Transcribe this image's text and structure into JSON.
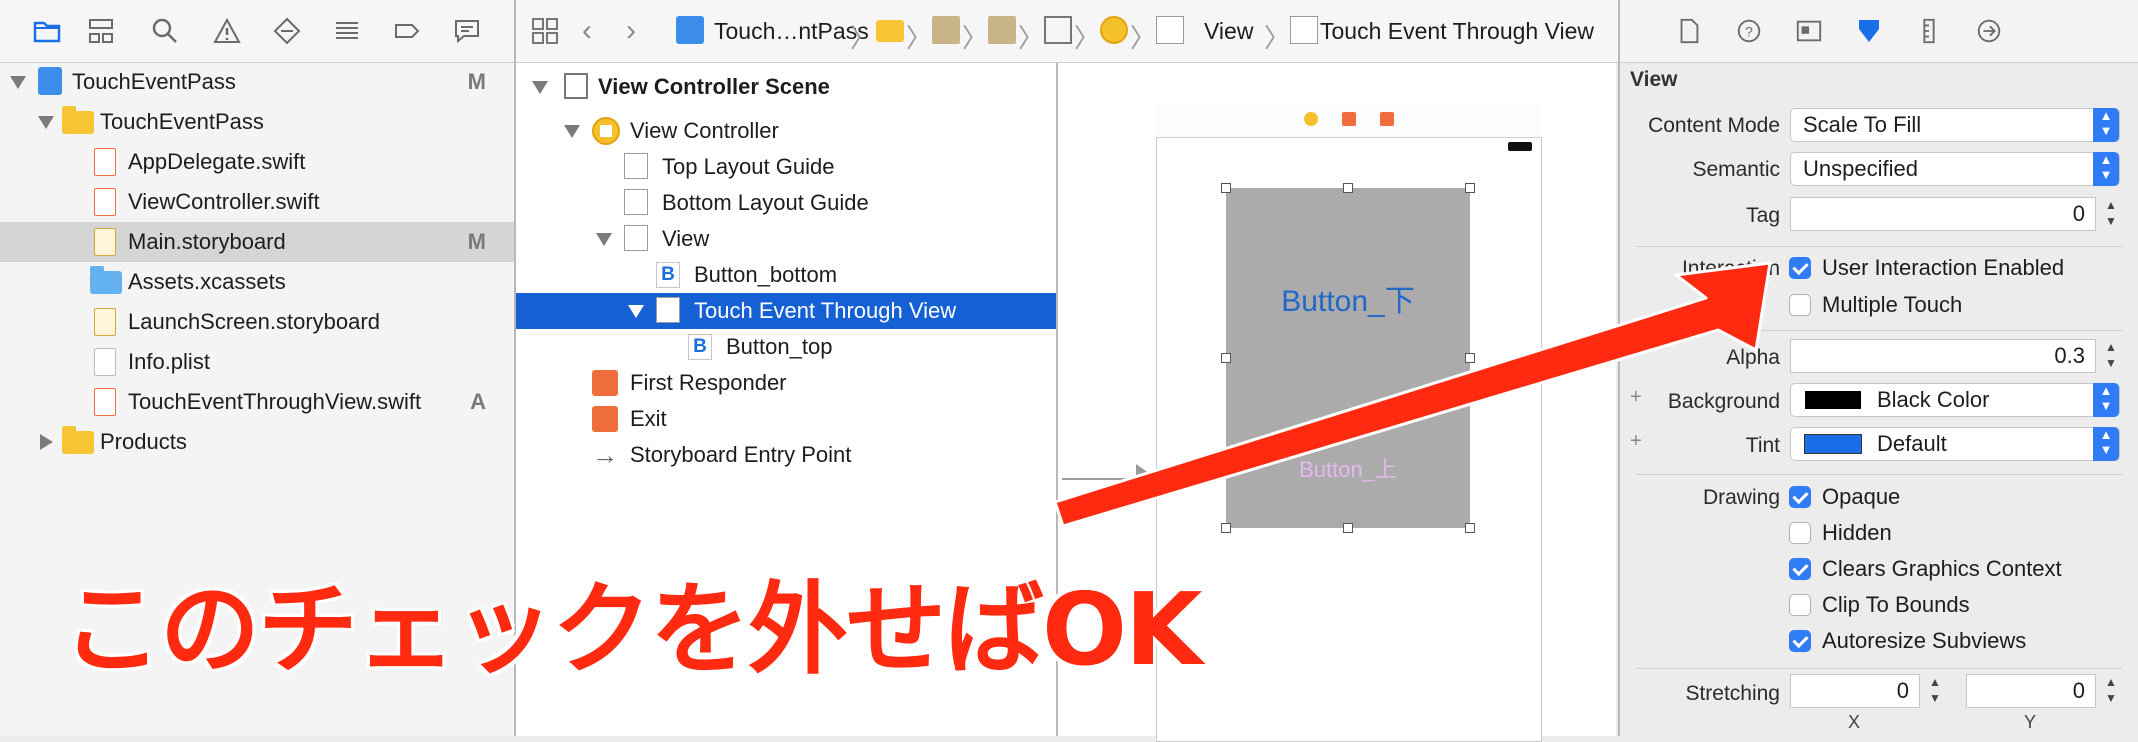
{
  "navigator": {
    "items": [
      {
        "label": "TouchEventPass",
        "badge": "M"
      },
      {
        "label": "TouchEventPass",
        "badge": ""
      },
      {
        "label": "AppDelegate.swift",
        "badge": ""
      },
      {
        "label": "ViewController.swift",
        "badge": ""
      },
      {
        "label": "Main.storyboard",
        "badge": "M"
      },
      {
        "label": "Assets.xcassets",
        "badge": ""
      },
      {
        "label": "LaunchScreen.storyboard",
        "badge": ""
      },
      {
        "label": "Info.plist",
        "badge": ""
      },
      {
        "label": "TouchEventThroughView.swift",
        "badge": "A"
      },
      {
        "label": "Products",
        "badge": ""
      }
    ]
  },
  "jumpbar": {
    "crumbs": [
      "Touch…ntPass",
      "View",
      "Touch Event Through View"
    ]
  },
  "outline": {
    "items": [
      "View Controller Scene",
      "View Controller",
      "Top Layout Guide",
      "Bottom Layout Guide",
      "View",
      "Button_bottom",
      "Touch Event Through View",
      "Button_top",
      "First Responder",
      "Exit",
      "Storyboard Entry Point"
    ],
    "b_glyph": "B"
  },
  "canvas": {
    "button_bottom": "Button_下",
    "button_top": "Button_上"
  },
  "inspector": {
    "section": "View",
    "content_mode_label": "Content Mode",
    "content_mode_value": "Scale To Fill",
    "semantic_label": "Semantic",
    "semantic_value": "Unspecified",
    "tag_label": "Tag",
    "tag_value": "0",
    "interaction_label": "Interaction",
    "user_interaction": "User Interaction Enabled",
    "multiple_touch": "Multiple Touch",
    "alpha_label": "Alpha",
    "alpha_value": "0.3",
    "background_label": "Background",
    "background_value": "Black Color",
    "tint_label": "Tint",
    "tint_value": "Default",
    "drawing_label": "Drawing",
    "opaque": "Opaque",
    "hidden": "Hidden",
    "clears_graphics": "Clears Graphics Context",
    "clip_bounds": "Clip To Bounds",
    "autoresize": "Autoresize Subviews",
    "stretching_label": "Stretching",
    "stretch_x_value": "0",
    "stretch_y_value": "0",
    "x_label": "X",
    "y_label": "Y",
    "plus": "+"
  },
  "annotation": {
    "text": "このチェックを外せばOK"
  },
  "colors": {
    "accent": "#2f7cf6",
    "selection": "#1560d4",
    "annotation_red": "#ff2a0f",
    "background_swatch": "#000000",
    "tint_swatch": "#1a6fe8"
  }
}
